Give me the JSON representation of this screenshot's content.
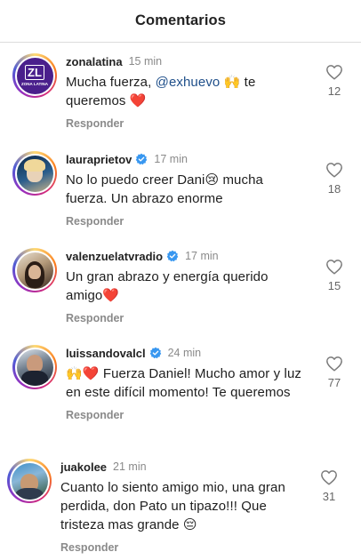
{
  "header": {
    "title": "Comentarios"
  },
  "comments": [
    {
      "username": "zonalatina",
      "verified": false,
      "time": "15 min",
      "text_before": "Mucha fuerza, ",
      "mention": "@exhuevo",
      "text_after": " 🙌 te queremos ❤️",
      "reply_label": "Responder",
      "likes": "12",
      "avatar_text": "ZL",
      "avatar_subtext": "ZONA LATINA"
    },
    {
      "username": "lauraprietov",
      "verified": true,
      "time": "17 min",
      "text": "No lo puedo creer Dani😢 mucha fuerza. Un abrazo enorme",
      "reply_label": "Responder",
      "likes": "18"
    },
    {
      "username": "valenzuelatvradio",
      "verified": true,
      "time": "17 min",
      "text": "Un gran abrazo y energía querido amigo❤️",
      "reply_label": "Responder",
      "likes": "15"
    },
    {
      "username": "luissandovalcl",
      "verified": true,
      "time": "24 min",
      "text": "🙌❤️ Fuerza Daniel! Mucho amor y luz en este difícil momento! Te queremos",
      "reply_label": "Responder",
      "likes": "77"
    },
    {
      "username": "juakolee",
      "verified": false,
      "time": "21 min",
      "text": "Cuanto lo siento amigo mio, una gran perdida, don Pato un tipazo!!! Que tristeza mas grande 😔",
      "reply_label": "Responder",
      "likes": "31"
    }
  ],
  "colors": {
    "verified": "#3897f0",
    "mention": "#1f4f8a",
    "muted": "#8a8a8a"
  },
  "icons": {
    "like": "heart-outline-icon",
    "verified": "verified-badge-icon"
  }
}
